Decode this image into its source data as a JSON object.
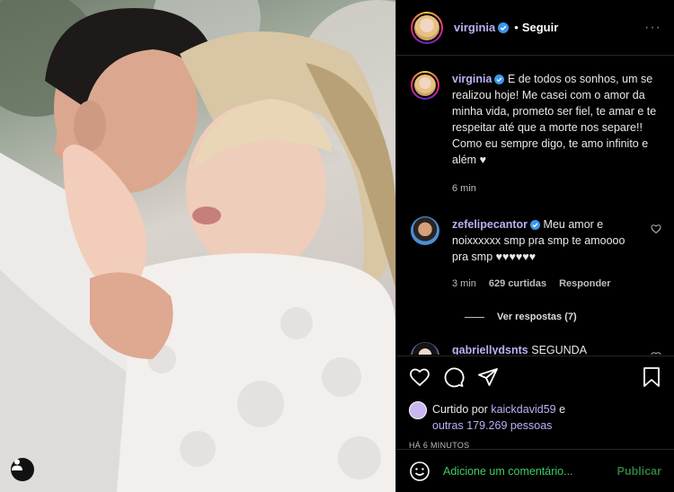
{
  "post": {
    "author": "virginia",
    "follow_label": "Seguir",
    "more_label": "···"
  },
  "caption": {
    "author": "virginia",
    "text": "E de todos os sonhos, um se realizou hoje! Me casei com o amor da minha vida, prometo ser fiel, te amar e te respeitar até que a morte nos separe!! Como eu sempre digo, te amo infinito e além ♥",
    "time": "6 min"
  },
  "comments": [
    {
      "author": "zefelipecantor",
      "text": "Meu amor e noixxxxxx smp pra smp te amoooo pra smp ♥♥♥♥♥♥",
      "time": "3 min",
      "likes": "629 curtidas",
      "reply_label": "Responder",
      "view_replies": "Ver respostas (7)"
    },
    {
      "author": "gabriellydsnts",
      "text": "SEGUNDA"
    }
  ],
  "likes": {
    "prefix": "Curtido por",
    "user": "kaickdavid59",
    "conj": "e",
    "others": "outras 179.269 pessoas"
  },
  "timestamp": "HÁ 6 MINUTOS",
  "add_comment": {
    "placeholder": "Adicione um comentário...",
    "submit_label": "Publicar"
  },
  "colors": {
    "username": "#b8b2f4",
    "placeholder": "#3dcc63",
    "submit": "#2f7d3f",
    "verified": "#3897f0"
  },
  "icons": [
    "heart-icon",
    "comment-icon",
    "share-icon",
    "bookmark-icon",
    "emoji-icon",
    "user-tag-icon",
    "verified-icon"
  ]
}
